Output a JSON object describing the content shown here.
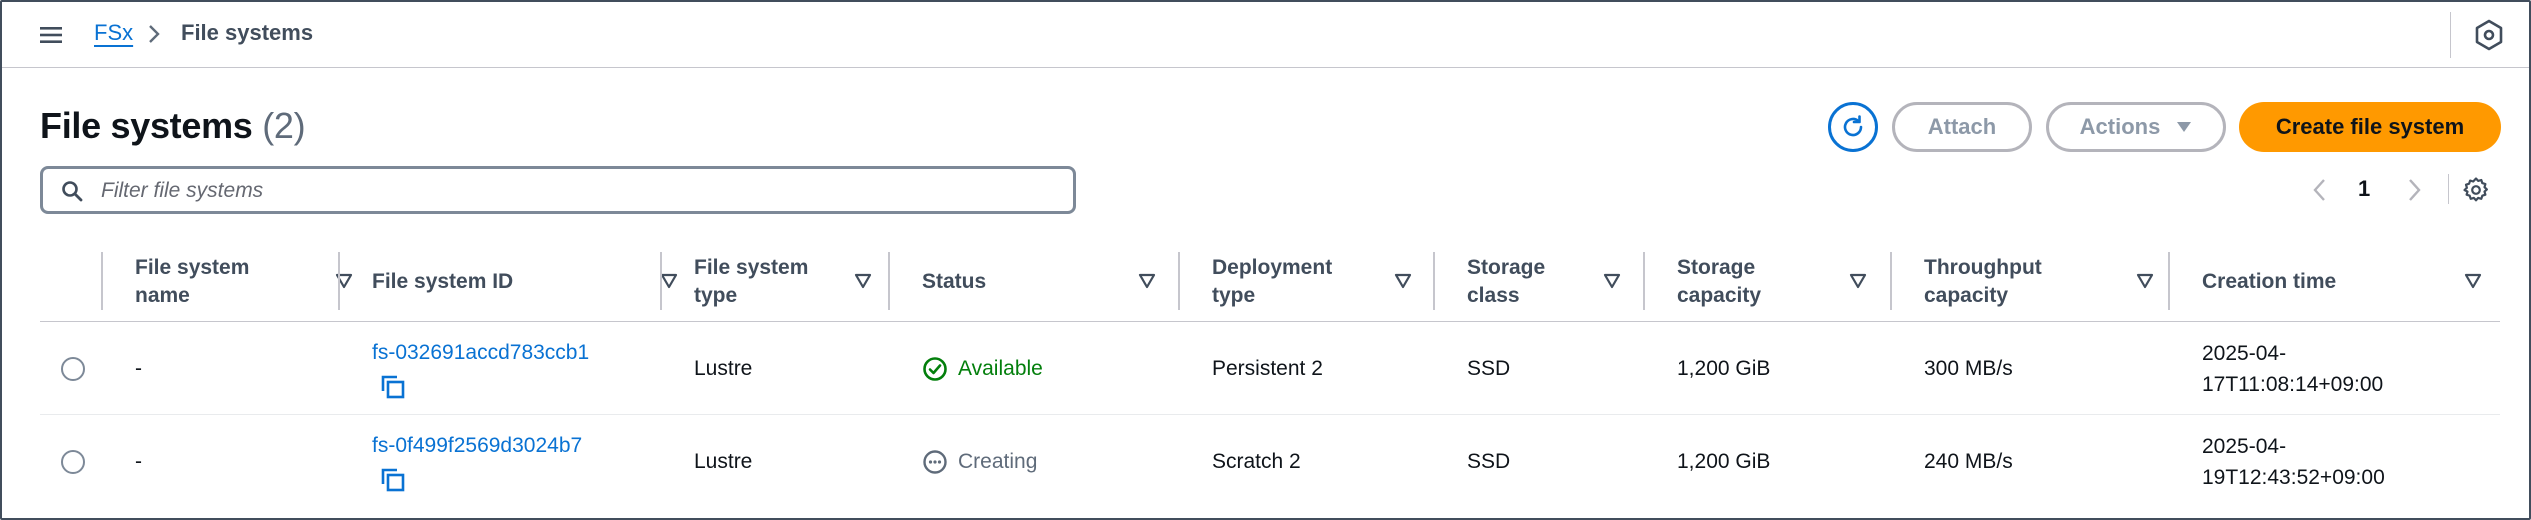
{
  "breadcrumb": {
    "root": "FSx",
    "current": "File systems"
  },
  "header": {
    "title": "File systems",
    "count": "(2)"
  },
  "buttons": {
    "attach": "Attach",
    "actions": "Actions",
    "create": "Create file system"
  },
  "filter": {
    "placeholder": "Filter file systems",
    "value": ""
  },
  "pagination": {
    "current_page": "1"
  },
  "table": {
    "columns": [
      {
        "line1": "File system",
        "line2": "name"
      },
      {
        "line1": "File system ID",
        "line2": ""
      },
      {
        "line1": "File system",
        "line2": "type"
      },
      {
        "line1": "Status",
        "line2": ""
      },
      {
        "line1": "Deployment",
        "line2": "type"
      },
      {
        "line1": "Storage",
        "line2": "class"
      },
      {
        "line1": "Storage",
        "line2": "capacity"
      },
      {
        "line1": "Throughput",
        "line2": "capacity"
      },
      {
        "line1": "Creation time",
        "line2": ""
      }
    ],
    "rows": [
      {
        "name": "-",
        "id": "fs-032691accd783ccb1",
        "type": "Lustre",
        "status": "Available",
        "deployment": "Persistent 2",
        "storage_class": "SSD",
        "storage_capacity": "1,200 GiB",
        "throughput": "300 MB/s",
        "created_line1": "2025-04-",
        "created_line2": "17T11:08:14+09:00"
      },
      {
        "name": "-",
        "id": "fs-0f499f2569d3024b7",
        "type": "Lustre",
        "status": "Creating",
        "deployment": "Scratch 2",
        "storage_class": "SSD",
        "storage_capacity": "1,200 GiB",
        "throughput": "240 MB/s",
        "created_line1": "2025-04-",
        "created_line2": "19T12:43:52+09:00"
      }
    ]
  },
  "icons": {
    "menu": "hamburger-icon",
    "breadcrumb_separator": "chevron-right-icon",
    "top_settings": "hexagon-settings-icon",
    "refresh": "refresh-icon",
    "actions_caret": "caret-down-icon",
    "search": "search-icon",
    "prev": "chevron-left-icon",
    "next": "chevron-right-icon",
    "preferences": "gear-icon",
    "sort": "caret-down-icon",
    "copy": "copy-icon",
    "available": "check-circle-icon",
    "creating": "ellipsis-circle-icon"
  },
  "colors": {
    "link": "#0972d3",
    "primary_button": "#ff9900",
    "available": "#037f0c",
    "pending": "#5f6b7a"
  }
}
